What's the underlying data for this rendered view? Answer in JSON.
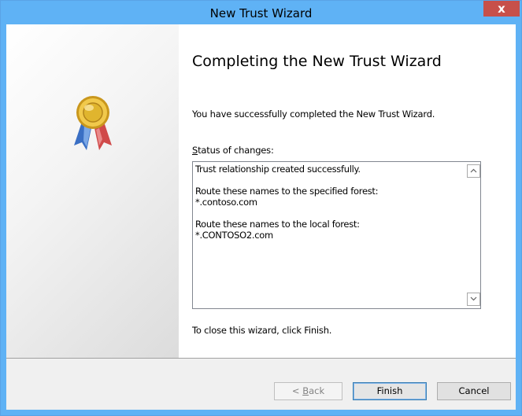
{
  "window": {
    "title": "New Trust Wizard",
    "close_label": "x"
  },
  "page": {
    "heading": "Completing the New Trust Wizard",
    "intro": "You have successfully completed the New Trust Wizard.",
    "status_label_mnemonic": "S",
    "status_label_rest": "tatus of changes:",
    "status_lines": {
      "line1": "Trust relationship created successfully.",
      "line2": "Route these names to the specified forest:",
      "line3": "*.contoso.com",
      "line4": "Route these names to the local forest:",
      "line5": "*.CONTOSO2.com"
    },
    "closing": "To close this wizard, click Finish."
  },
  "buttons": {
    "back_prefix": "< ",
    "back_mnemonic": "B",
    "back_rest": "ack",
    "finish": "Finish",
    "cancel": "Cancel"
  },
  "icons": {
    "badge": "award-ribbon-icon",
    "scroll_up": "chevron-up-icon",
    "scroll_down": "chevron-down-icon"
  },
  "colors": {
    "titlebar": "#5fb2f5",
    "close_button": "#c7504a",
    "badge_gold": "#e0b52e",
    "ribbon_blue": "#3a6fc4",
    "ribbon_red": "#d04a4a"
  }
}
